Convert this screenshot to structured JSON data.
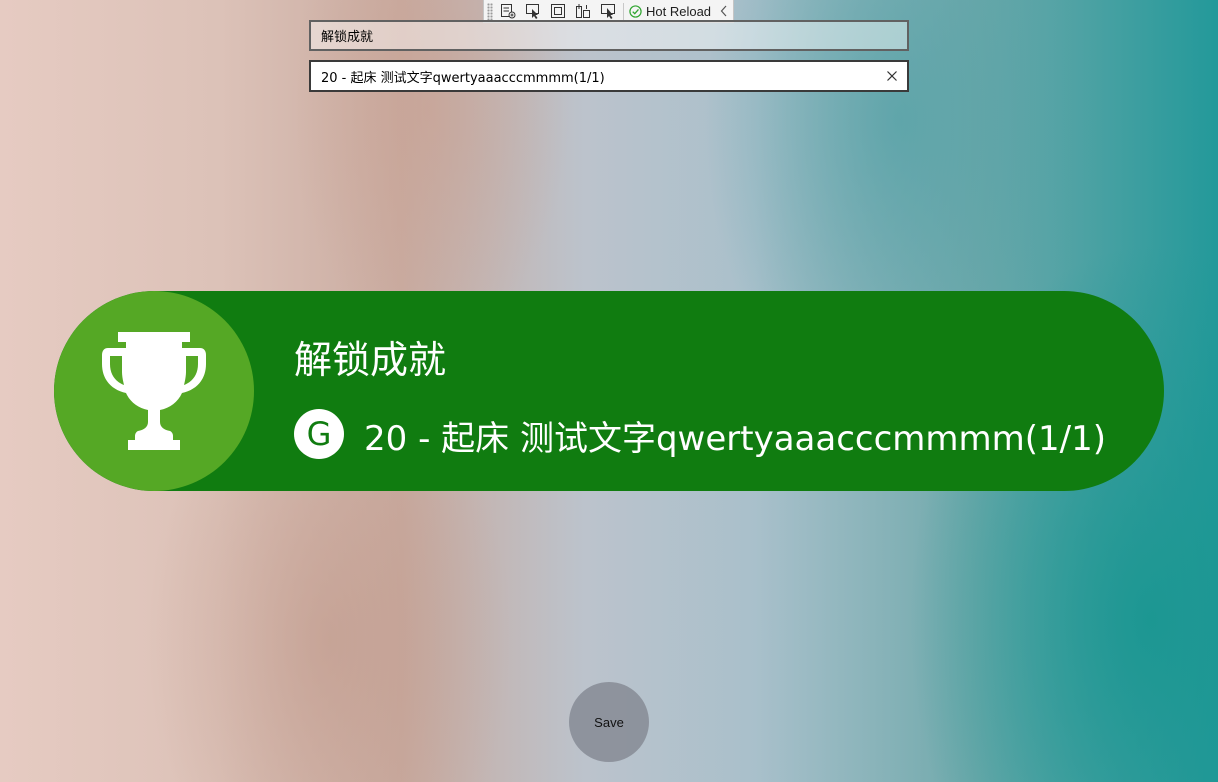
{
  "toolbar": {
    "hot_reload_label": "Hot Reload",
    "icons": [
      "select-element-icon",
      "pointer-select-icon",
      "layout-adorner-icon",
      "track-focus-icon",
      "display-layout-icon"
    ],
    "status_color": "#2fa52f"
  },
  "form": {
    "title_value": "解锁成就",
    "description_value": "20 - 起床 测试文字qwertyaaacccmmmm(1/1)"
  },
  "toast": {
    "title": "解锁成就",
    "badge_letter": "G",
    "description": "20 - 起床 测试文字qwertyaaacccmmmm(1/1)",
    "bg_color": "#107c10",
    "icon_bg_color": "#55a825"
  },
  "actions": {
    "save_label": "Save"
  }
}
